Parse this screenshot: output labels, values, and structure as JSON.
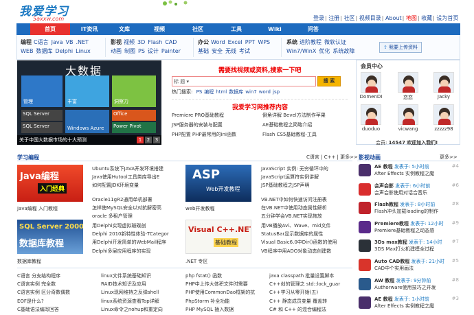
{
  "logo": {
    "text": "我爱学习",
    "domain": "5axxw.com"
  },
  "top_links": [
    "登录",
    "注册",
    "社区",
    "视频目录",
    "About",
    "地图",
    "收藏",
    "设为首页"
  ],
  "nav": [
    "首页",
    "IT资讯",
    "文库",
    "视频",
    "社区",
    "工具",
    "Wiki",
    "问答"
  ],
  "subnav": [
    {
      "label": "编程",
      "items": [
        "C语言",
        "Java",
        "VB",
        ".NET"
      ],
      "items2": [
        "WEB",
        "数据库",
        "Delphi",
        "Linux"
      ]
    },
    {
      "label": "影视",
      "items": [
        "视频",
        "3D",
        "Flash",
        "CAD"
      ],
      "items2": [
        "动画",
        "制图",
        "PS",
        "设计",
        "Painter"
      ]
    },
    {
      "label": "办公",
      "items": [
        "Word",
        "Excel",
        "PPT",
        "WPS"
      ],
      "items2": [
        "基础",
        "安全",
        "无线",
        "考试"
      ]
    },
    {
      "label": "系统",
      "items": [
        "进阶教程",
        "微软认证"
      ],
      "items2": [
        "Win7/WinX",
        "优化",
        "系统故障"
      ]
    }
  ],
  "upload_btn": "我要上传资料",
  "banner": {
    "title": "大数据",
    "tiles": [
      "管理",
      "丰富",
      "洞察力",
      "SQL Server",
      "SQL Server",
      "Windows Azure",
      "Office",
      "Power Pivot"
    ],
    "caption": "关于中国大数据市场的十大预测",
    "pages": [
      "1",
      "2",
      "3"
    ]
  },
  "search": {
    "heading": "需要找视频或资料,搜索一下吧",
    "select": "标 题",
    "button": "搜 索",
    "hot_label": "热门搜索:",
    "hot": [
      "PS",
      "编程",
      "html",
      "数据库",
      "win7",
      "word",
      "jsp"
    ]
  },
  "recommend": {
    "heading": "我爱学习网推荐内容",
    "items": [
      "Premiere PRO基础教程",
      "倒角详解 Bevel方法制作苹果",
      "JSP服务器的安装与配置",
      "AE基础教程之简略介绍",
      "PHP配置 PHP最常用的ini函数",
      "Flash CS5基础教程-工具"
    ]
  },
  "member": {
    "title": "会员中心",
    "users": [
      "DomenDI",
      "恋恋",
      "Jacky",
      "duoduo",
      "vicwang",
      "zzzzz98"
    ],
    "count_label": "会员:",
    "count": "14547",
    "welcome": "欢迎加入我们!"
  },
  "study": {
    "title": "学习编程",
    "tags": "C语言 | C++ | 更多>>",
    "books": [
      {
        "title": "Java编程",
        "sub": "入门经典",
        "caption": "Java编程 入门教程"
      },
      {
        "title": "ASP",
        "sub": "Web开发教程",
        "caption": "web开发教程"
      },
      {
        "title": "SQL Server 2000",
        "sub": "数据库教程",
        "caption": "数据库教程"
      },
      {
        "title": "Visual C++.NET",
        "sub": "基础教程",
        "caption": ".NET 专区"
      }
    ],
    "col1a": [
      "Ubuntu系统下JAVA开发环境搭建",
      "Java使用Hutool工具类库导出E",
      "如何配置JDK环境变量"
    ],
    "col1b": [
      "Oracle11gR2通用单机部署",
      "怎样使MySQL安全以对抗解密高",
      "oracle 多租户管理"
    ],
    "col2a": [
      "JavaScript 实例: 无穷循环中的",
      "JavaScript运算符实例讲解",
      "JSP基础教程之JSP声明"
    ],
    "col2b": [
      "VB.NET中如何快速访问注册表",
      "在VB.NET中使用动态属性解析",
      "五分钟学会VB.NET实现拖放"
    ],
    "col3a": [
      "用Delphi实现虚拟磁碟剖",
      "Delphi 2010新特性体验-TCategor",
      "用Delphi开发简单的WebMail程序",
      "Delphi多层应用程序的实现"
    ],
    "col3b": [
      "用VB播放Avi、Wave、mid文件",
      "StatusBar显示数据库的属性",
      "Visual Basic6.0中Dir()函数的使用",
      "VB程序中用ADO对象动态创建数"
    ],
    "bottom": [
      [
        "C语言 分支结构程序",
        "C语言实例 完全数",
        "C语言实例 区分奇数偶数",
        "EOF是什么?",
        "C基础语法编写回答"
      ],
      [
        "linux文件系统基础知识",
        "RAID技术知识及应用",
        "Linux现网维持之反弹shell",
        "linux系统资源查看Top详解",
        "Linux命令之nohup和重定向"
      ],
      [
        "php fstat() 函数",
        "PHP中上传大体积文件时需要",
        "PHP使用CommonDao框架的抗",
        "PhpStorm 补全功能",
        "PHP MySQL 插入数据"
      ],
      [
        "java classpath 批量设置脚本",
        "C++创的管理之 std::lock_guar",
        "C++学习从零开始(五)",
        "C++ 静态成员变量 覆盖转",
        "C# 和 C++ 的混合编程法"
      ]
    ]
  },
  "videos": {
    "title": "影视动画",
    "more": "更多>>",
    "items": [
      {
        "name": "AE 教程",
        "time": "发表于: 5小时前",
        "desc": "After Effects 实例教程之魔",
        "num": "#4",
        "color": "#4a2f6b"
      },
      {
        "name": "会声会影",
        "time": "发表于: 6小时前",
        "desc": "会声会影使用对话合音乐",
        "num": "#6",
        "color": "#d92d2d"
      },
      {
        "name": "Flash教程",
        "time": "发表于: 8小时前",
        "desc": "Flash冲头加载loading的制作",
        "num": "#8",
        "color": "#c0232b"
      },
      {
        "name": "Premiere教程",
        "time": "发表于: 12小时",
        "desc": "Premiere基础教程之动态感",
        "num": "#9",
        "color": "#5a2a8a"
      },
      {
        "name": "3Ds max教程",
        "time": "发表于: 14小时",
        "desc": "3DS Max打火机建模全过程",
        "num": "#7",
        "color": "#2b3138"
      },
      {
        "name": "Auto CAD教程",
        "time": "发表于: 21小时",
        "desc": "CAD中个实用画法",
        "num": "#5",
        "color": "#d9342b"
      },
      {
        "name": "AW 教程",
        "time": "发表于: 9分钟前",
        "desc": "Authorware使用技巧之开发",
        "num": "#8",
        "color": "#2a5a8c"
      },
      {
        "name": "AE 教程",
        "time": "发表于: 1小时前",
        "desc": "After Effects 实例教程之魔",
        "num": "#3",
        "color": "#4a2f6b"
      }
    ]
  }
}
